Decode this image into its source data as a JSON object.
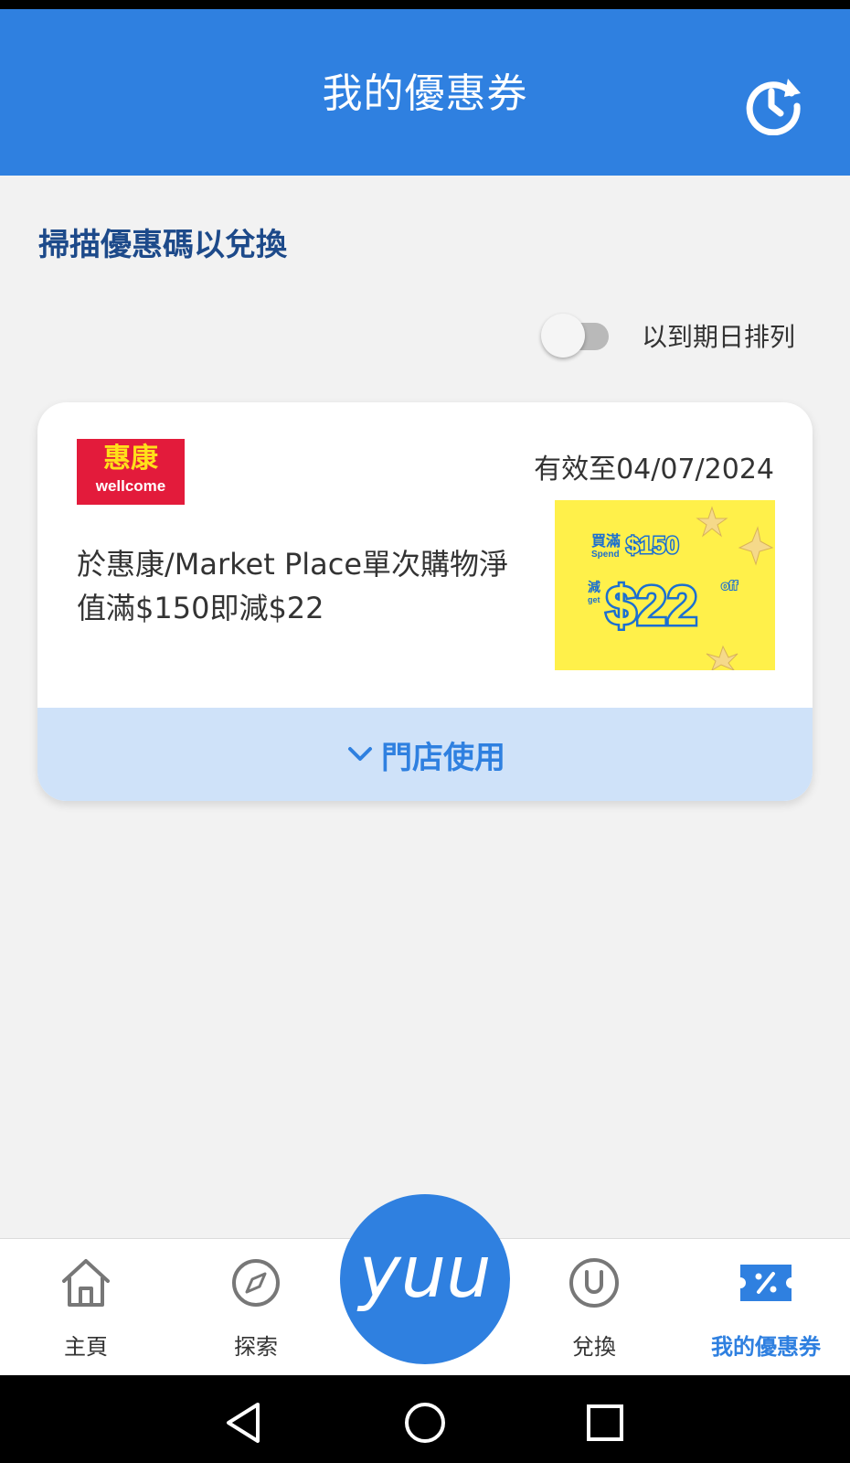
{
  "header": {
    "title": "我的優惠券",
    "history_icon": "history-icon"
  },
  "main": {
    "scan_title": "掃描優惠碼以兌換",
    "sort_label": "以到期日排列",
    "sort_toggle_on": false
  },
  "coupon": {
    "brand_logo_zh": "惠康",
    "brand_logo_en": "wellcome",
    "valid_until": "有效至04/07/2024",
    "description": "於惠康/Market Place單次購物淨值滿$150即減$22",
    "promo": {
      "line1_zh": "買滿",
      "line1_en": "Spend",
      "spend_amount": "$150",
      "line2_zh": "減",
      "line2_en": "get",
      "get_amount": "$22",
      "off_label": "off"
    },
    "footer_label": "門店使用"
  },
  "bottom_nav": {
    "items": [
      {
        "label": "主頁",
        "icon": "home-icon"
      },
      {
        "label": "探索",
        "icon": "compass-icon"
      },
      {
        "label": "兌換",
        "icon": "redeem-icon"
      },
      {
        "label": "我的優惠券",
        "icon": "coupon-icon"
      }
    ],
    "center_label": "yuu",
    "active_index": 3
  },
  "colors": {
    "primary": "#2f80e0",
    "title_dark": "#1d4a8a",
    "card_footer": "#cfe2f9",
    "brand_red": "#e31b3b",
    "promo_yellow": "#fff04a"
  }
}
